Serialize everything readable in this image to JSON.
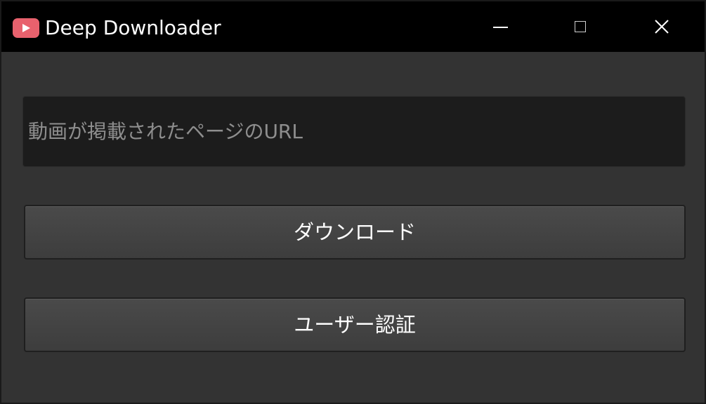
{
  "window": {
    "title": "Deep Downloader",
    "icon": "youtube-play-icon",
    "icon_color": "#e8616d",
    "controls": {
      "minimize": "minimize-icon",
      "maximize": "maximize-icon",
      "close": "close-icon"
    }
  },
  "form": {
    "url_value": "",
    "url_placeholder": "動画が掲載されたページのURL",
    "download_label": "ダウンロード",
    "auth_label": "ユーザー認証"
  },
  "colors": {
    "background": "#333333",
    "titlebar": "#000000",
    "input_bg": "#1c1c1c",
    "button_bg": "#444444",
    "text": "#ffffff",
    "placeholder": "#8e8e8e"
  }
}
